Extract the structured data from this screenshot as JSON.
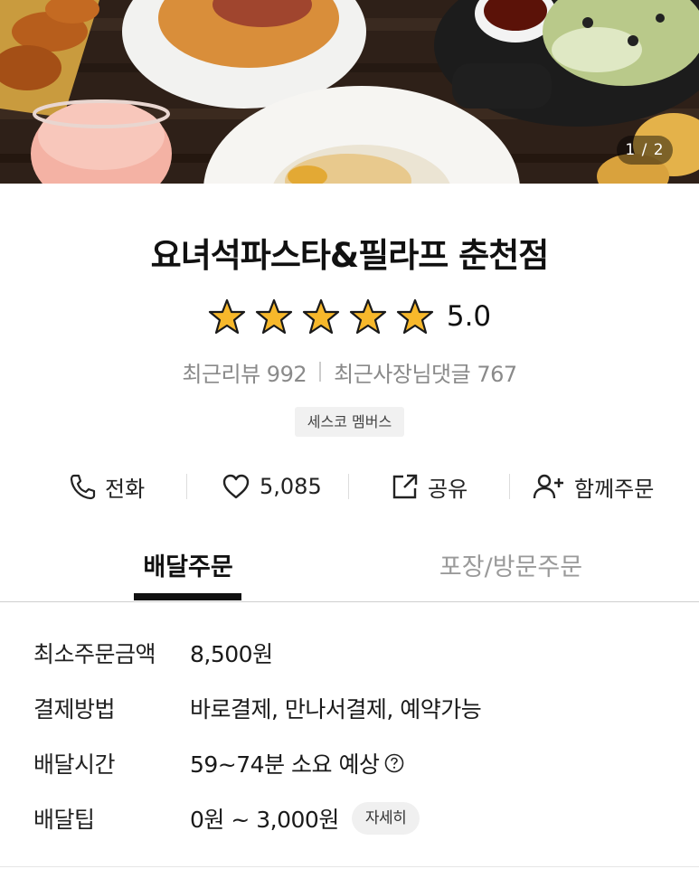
{
  "hero": {
    "counter": "1 / 2"
  },
  "store": {
    "name": "요녀석파스타&필라프 춘천점",
    "rating": {
      "stars": 5,
      "value": "5.0",
      "star_color": "#f7b82b"
    },
    "recent_reviews": "최근리뷰 992",
    "owner_replies": "최근사장님댓글 767",
    "badge": "세스코 멤버스"
  },
  "actions": {
    "call": {
      "label": "전화",
      "icon": "phone-icon"
    },
    "like": {
      "label": "5,085",
      "icon": "heart-icon"
    },
    "share": {
      "label": "공유",
      "icon": "share-icon"
    },
    "group_order": {
      "label": "함께주문",
      "icon": "add-person-icon"
    }
  },
  "tabs": [
    {
      "label": "배달주문",
      "active": true
    },
    {
      "label": "포장/방문주문",
      "active": false
    }
  ],
  "info": {
    "min_order": {
      "label": "최소주문금액",
      "value": "8,500원"
    },
    "payment": {
      "label": "결제방법",
      "value": "바로결제, 만나서결제, 예약가능"
    },
    "delivery_time": {
      "label": "배달시간",
      "value": "59~74분 소요 예상",
      "icon": "help-icon"
    },
    "delivery_tip": {
      "label": "배달팁",
      "value": "0원 ~ 3,000원",
      "detail_label": "자세히"
    }
  }
}
